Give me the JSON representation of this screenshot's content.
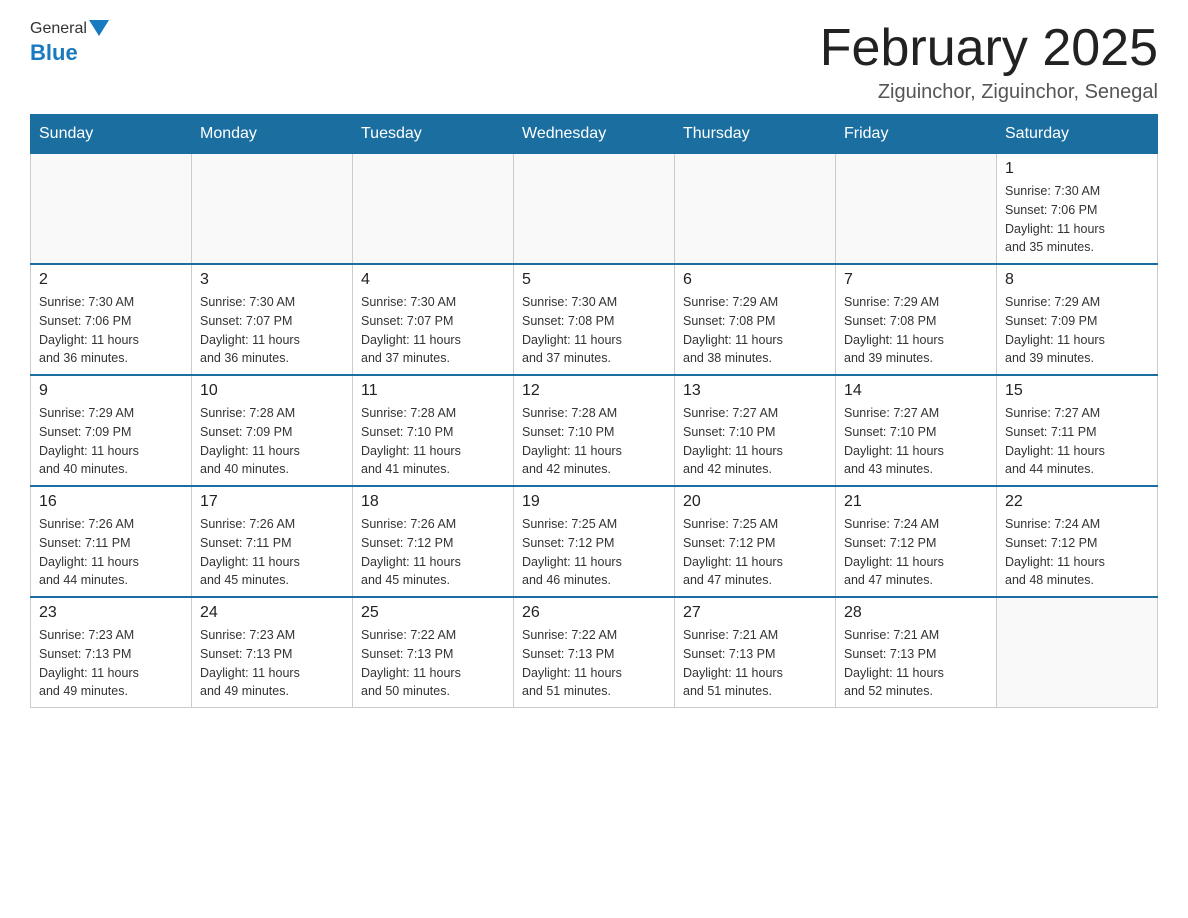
{
  "header": {
    "title": "February 2025",
    "location": "Ziguinchor, Ziguinchor, Senegal"
  },
  "days_of_week": [
    "Sunday",
    "Monday",
    "Tuesday",
    "Wednesday",
    "Thursday",
    "Friday",
    "Saturday"
  ],
  "weeks": [
    [
      {
        "day": "",
        "info": []
      },
      {
        "day": "",
        "info": []
      },
      {
        "day": "",
        "info": []
      },
      {
        "day": "",
        "info": []
      },
      {
        "day": "",
        "info": []
      },
      {
        "day": "",
        "info": []
      },
      {
        "day": "1",
        "info": [
          "Sunrise: 7:30 AM",
          "Sunset: 7:06 PM",
          "Daylight: 11 hours",
          "and 35 minutes."
        ]
      }
    ],
    [
      {
        "day": "2",
        "info": [
          "Sunrise: 7:30 AM",
          "Sunset: 7:06 PM",
          "Daylight: 11 hours",
          "and 36 minutes."
        ]
      },
      {
        "day": "3",
        "info": [
          "Sunrise: 7:30 AM",
          "Sunset: 7:07 PM",
          "Daylight: 11 hours",
          "and 36 minutes."
        ]
      },
      {
        "day": "4",
        "info": [
          "Sunrise: 7:30 AM",
          "Sunset: 7:07 PM",
          "Daylight: 11 hours",
          "and 37 minutes."
        ]
      },
      {
        "day": "5",
        "info": [
          "Sunrise: 7:30 AM",
          "Sunset: 7:08 PM",
          "Daylight: 11 hours",
          "and 37 minutes."
        ]
      },
      {
        "day": "6",
        "info": [
          "Sunrise: 7:29 AM",
          "Sunset: 7:08 PM",
          "Daylight: 11 hours",
          "and 38 minutes."
        ]
      },
      {
        "day": "7",
        "info": [
          "Sunrise: 7:29 AM",
          "Sunset: 7:08 PM",
          "Daylight: 11 hours",
          "and 39 minutes."
        ]
      },
      {
        "day": "8",
        "info": [
          "Sunrise: 7:29 AM",
          "Sunset: 7:09 PM",
          "Daylight: 11 hours",
          "and 39 minutes."
        ]
      }
    ],
    [
      {
        "day": "9",
        "info": [
          "Sunrise: 7:29 AM",
          "Sunset: 7:09 PM",
          "Daylight: 11 hours",
          "and 40 minutes."
        ]
      },
      {
        "day": "10",
        "info": [
          "Sunrise: 7:28 AM",
          "Sunset: 7:09 PM",
          "Daylight: 11 hours",
          "and 40 minutes."
        ]
      },
      {
        "day": "11",
        "info": [
          "Sunrise: 7:28 AM",
          "Sunset: 7:10 PM",
          "Daylight: 11 hours",
          "and 41 minutes."
        ]
      },
      {
        "day": "12",
        "info": [
          "Sunrise: 7:28 AM",
          "Sunset: 7:10 PM",
          "Daylight: 11 hours",
          "and 42 minutes."
        ]
      },
      {
        "day": "13",
        "info": [
          "Sunrise: 7:27 AM",
          "Sunset: 7:10 PM",
          "Daylight: 11 hours",
          "and 42 minutes."
        ]
      },
      {
        "day": "14",
        "info": [
          "Sunrise: 7:27 AM",
          "Sunset: 7:10 PM",
          "Daylight: 11 hours",
          "and 43 minutes."
        ]
      },
      {
        "day": "15",
        "info": [
          "Sunrise: 7:27 AM",
          "Sunset: 7:11 PM",
          "Daylight: 11 hours",
          "and 44 minutes."
        ]
      }
    ],
    [
      {
        "day": "16",
        "info": [
          "Sunrise: 7:26 AM",
          "Sunset: 7:11 PM",
          "Daylight: 11 hours",
          "and 44 minutes."
        ]
      },
      {
        "day": "17",
        "info": [
          "Sunrise: 7:26 AM",
          "Sunset: 7:11 PM",
          "Daylight: 11 hours",
          "and 45 minutes."
        ]
      },
      {
        "day": "18",
        "info": [
          "Sunrise: 7:26 AM",
          "Sunset: 7:12 PM",
          "Daylight: 11 hours",
          "and 45 minutes."
        ]
      },
      {
        "day": "19",
        "info": [
          "Sunrise: 7:25 AM",
          "Sunset: 7:12 PM",
          "Daylight: 11 hours",
          "and 46 minutes."
        ]
      },
      {
        "day": "20",
        "info": [
          "Sunrise: 7:25 AM",
          "Sunset: 7:12 PM",
          "Daylight: 11 hours",
          "and 47 minutes."
        ]
      },
      {
        "day": "21",
        "info": [
          "Sunrise: 7:24 AM",
          "Sunset: 7:12 PM",
          "Daylight: 11 hours",
          "and 47 minutes."
        ]
      },
      {
        "day": "22",
        "info": [
          "Sunrise: 7:24 AM",
          "Sunset: 7:12 PM",
          "Daylight: 11 hours",
          "and 48 minutes."
        ]
      }
    ],
    [
      {
        "day": "23",
        "info": [
          "Sunrise: 7:23 AM",
          "Sunset: 7:13 PM",
          "Daylight: 11 hours",
          "and 49 minutes."
        ]
      },
      {
        "day": "24",
        "info": [
          "Sunrise: 7:23 AM",
          "Sunset: 7:13 PM",
          "Daylight: 11 hours",
          "and 49 minutes."
        ]
      },
      {
        "day": "25",
        "info": [
          "Sunrise: 7:22 AM",
          "Sunset: 7:13 PM",
          "Daylight: 11 hours",
          "and 50 minutes."
        ]
      },
      {
        "day": "26",
        "info": [
          "Sunrise: 7:22 AM",
          "Sunset: 7:13 PM",
          "Daylight: 11 hours",
          "and 51 minutes."
        ]
      },
      {
        "day": "27",
        "info": [
          "Sunrise: 7:21 AM",
          "Sunset: 7:13 PM",
          "Daylight: 11 hours",
          "and 51 minutes."
        ]
      },
      {
        "day": "28",
        "info": [
          "Sunrise: 7:21 AM",
          "Sunset: 7:13 PM",
          "Daylight: 11 hours",
          "and 52 minutes."
        ]
      },
      {
        "day": "",
        "info": []
      }
    ]
  ]
}
